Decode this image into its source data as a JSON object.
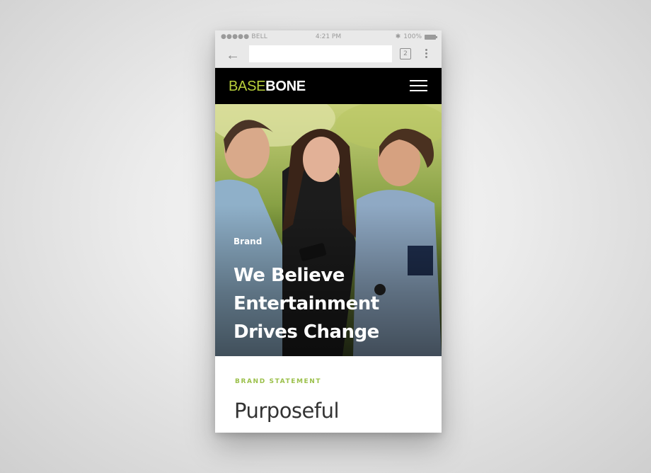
{
  "status_bar": {
    "carrier": "●●●●● BELL",
    "time": "4:21 PM",
    "battery": "100%"
  },
  "browser": {
    "url": "",
    "tab_count": "2"
  },
  "site": {
    "logo_part1": "BASE",
    "logo_part2": "BONE"
  },
  "hero": {
    "eyebrow": "Brand",
    "title_line1": "We Believe",
    "title_line2": "Entertainment",
    "title_line3": "Drives Change"
  },
  "section": {
    "kicker": "BRAND STATEMENT",
    "heading": "Purposeful"
  },
  "colors": {
    "accent": "#b7cf3a",
    "kicker": "#9bc04a",
    "nav_bg": "#000000"
  }
}
